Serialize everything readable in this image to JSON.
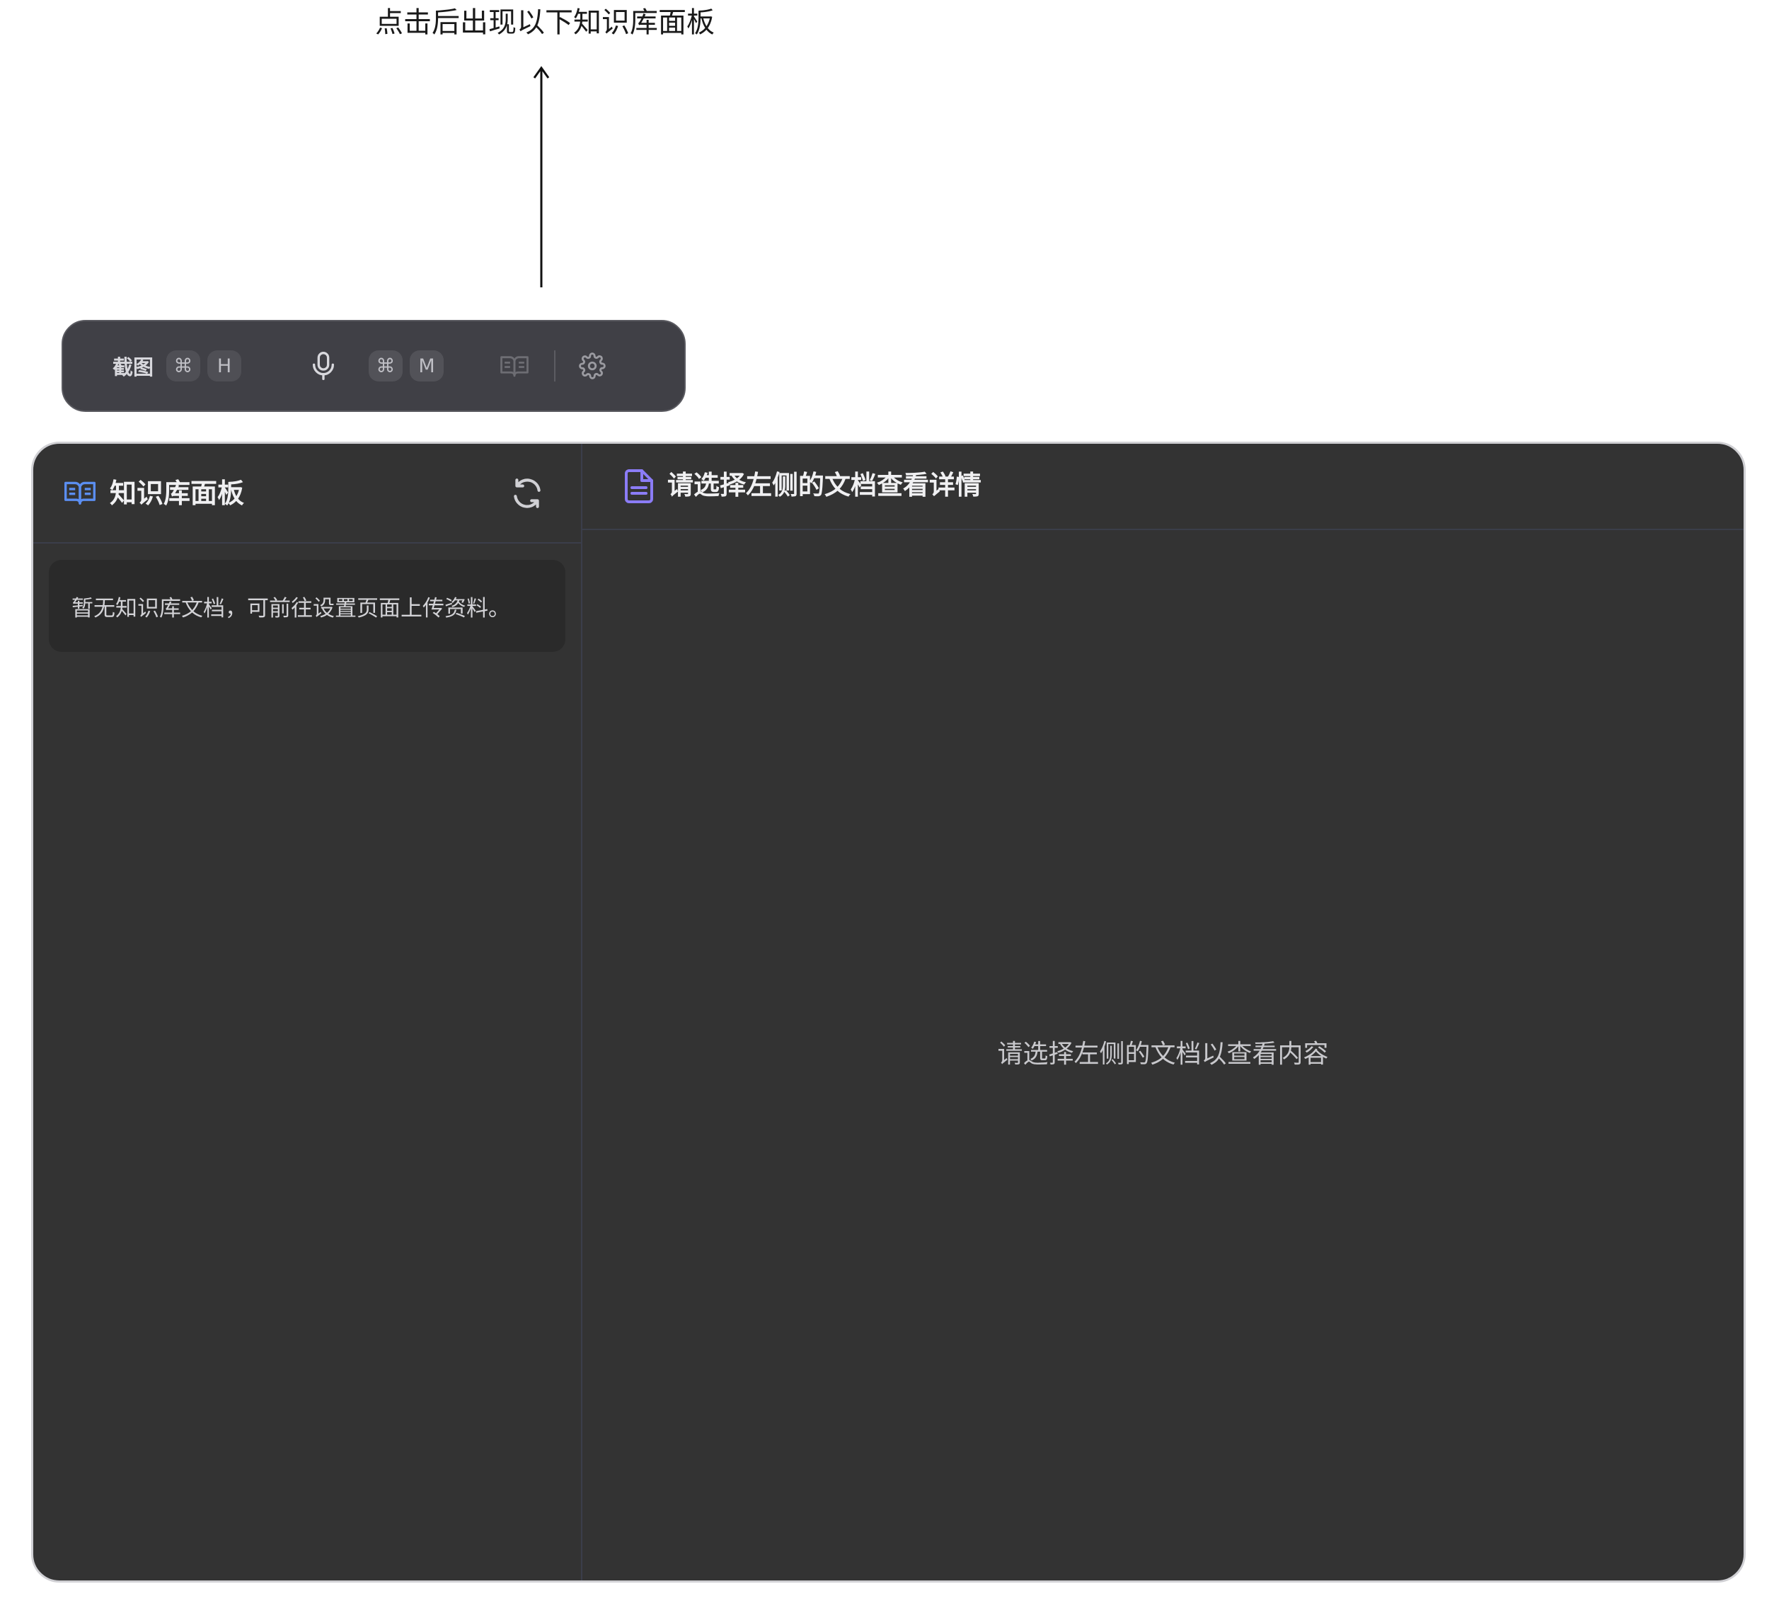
{
  "annotation": {
    "text": "点击后出现以下知识库面板"
  },
  "toolbar": {
    "screenshot_label": "截图",
    "screenshot_shortcut": [
      "⌘",
      "H"
    ],
    "mic_shortcut": [
      "⌘",
      "M"
    ],
    "icons": [
      "microphone-icon",
      "book-icon",
      "gear-icon"
    ]
  },
  "sidebar": {
    "title": "知识库面板",
    "empty_message": "暂无知识库文档，可前往设置页面上传资料。"
  },
  "main": {
    "title": "请选择左侧的文档查看详情",
    "placeholder": "请选择左侧的文档以查看内容"
  },
  "colors": {
    "accent_blue": "#5b8ef0",
    "accent_purple": "#8b7cf6",
    "panel_bg": "#333333",
    "toolbar_bg": "#404046"
  }
}
